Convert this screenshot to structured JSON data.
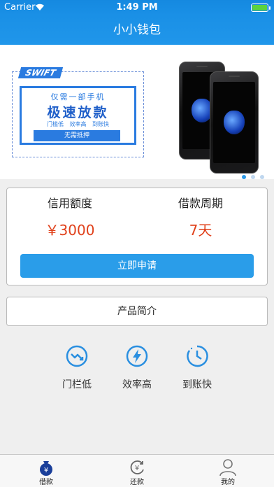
{
  "status_bar": {
    "carrier": "Carrier",
    "time": "1:49 PM"
  },
  "nav": {
    "title": "小小钱包"
  },
  "banner": {
    "badge": "SWIFT",
    "line1": "仅需一部手机",
    "line2": "极速放款",
    "tags": [
      "门槛低",
      "效率高",
      "到账快"
    ],
    "button": "无需抵押",
    "page_count": 3,
    "active_page": 0
  },
  "loan_card": {
    "credit_label": "信用额度",
    "credit_value": "￥3000",
    "period_label": "借款周期",
    "period_value": "7天",
    "apply_button": "立即申请"
  },
  "product_intro": {
    "label": "产品简介"
  },
  "features": [
    {
      "icon": "trend-down-icon",
      "label": "门栏低"
    },
    {
      "icon": "lightning-icon",
      "label": "效率高"
    },
    {
      "icon": "clock-icon",
      "label": "到账快"
    }
  ],
  "tab_bar": [
    {
      "icon": "money-bag-icon",
      "label": "借款",
      "active": true
    },
    {
      "icon": "repay-icon",
      "label": "还款",
      "active": false
    },
    {
      "icon": "user-icon",
      "label": "我的",
      "active": false
    }
  ],
  "colors": {
    "primary": "#1a90e6",
    "accent_value": "#e0401a",
    "button": "#2a9de9"
  }
}
